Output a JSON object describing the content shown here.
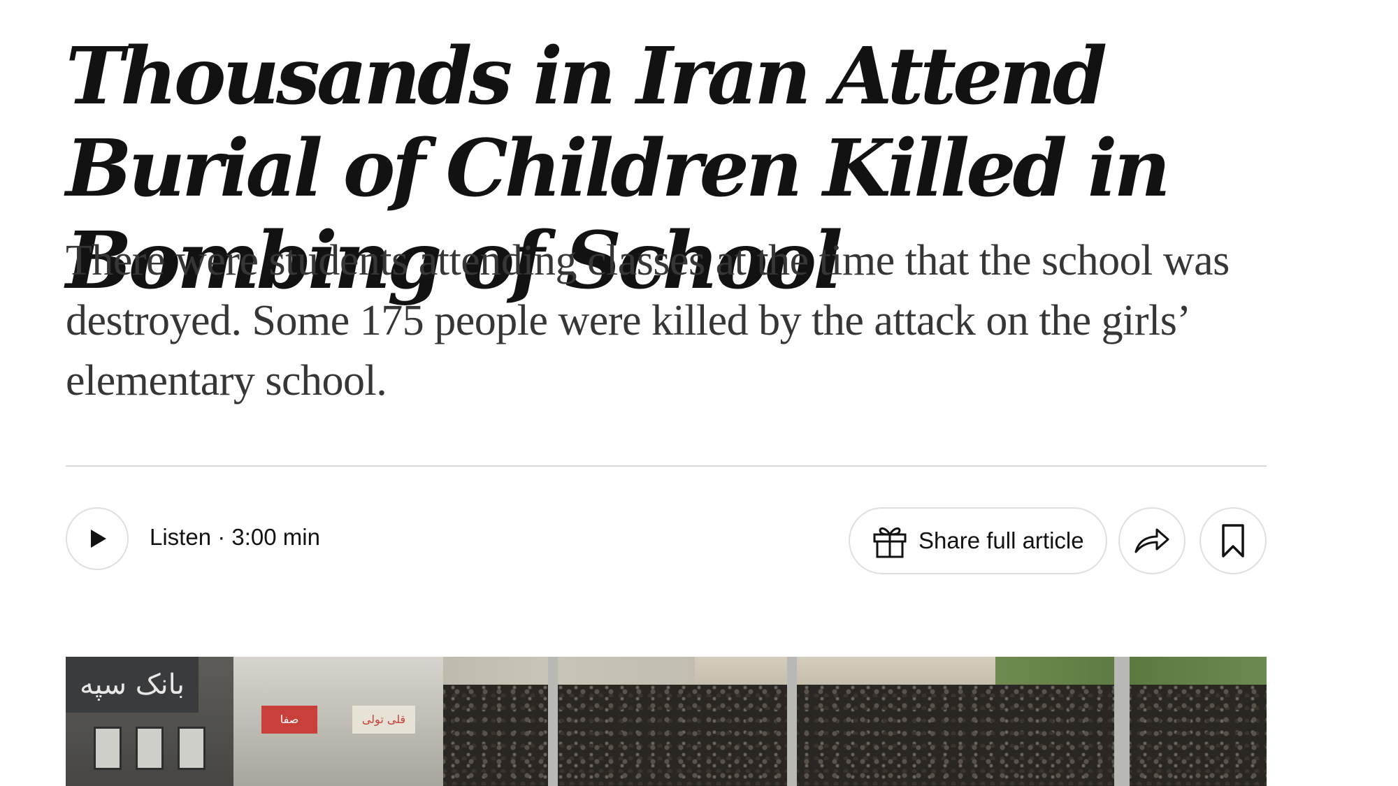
{
  "article": {
    "headline": "Thousands in Iran Attend Burial of Children Killed in Bombing of School",
    "summary": "There were students attending classes at the time that the school was destroyed. Some 175 people were killed by the attack on the girls’ elementary school."
  },
  "toolbar": {
    "listen_label": "Listen · 3:00 min",
    "share_full_article_label": "Share full article",
    "icons": {
      "play": "play-icon",
      "gift": "gift-icon",
      "share": "share-arrow-icon",
      "save": "bookmark-icon"
    }
  },
  "lead_photo": {
    "signs": [
      "بانک سپه",
      "صفا",
      "قلی تولی"
    ]
  },
  "colors": {
    "text_primary": "#121212",
    "text_summary": "#363636",
    "divider": "#d9d9d9",
    "button_border": "#dfdfdf"
  }
}
